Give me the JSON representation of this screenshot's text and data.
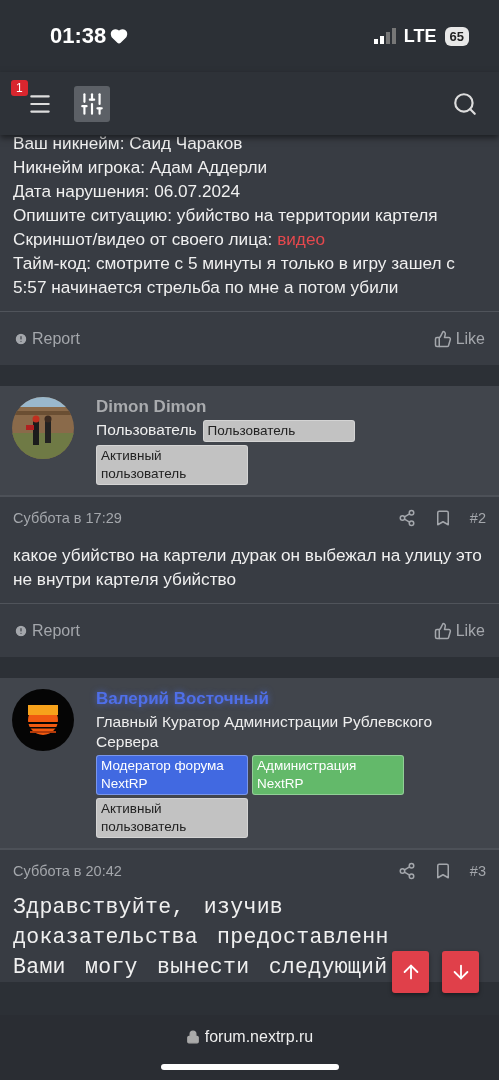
{
  "status_bar": {
    "time": "01:38",
    "network": "LTE",
    "battery": "65"
  },
  "header": {
    "notification_badge": "1"
  },
  "posts": [
    {
      "kind": "continued",
      "lines": [
        {
          "text": "Ваш никнейм: Саид Чараков"
        },
        {
          "text": "Никнейм игрока: Адам Аддерли"
        },
        {
          "text": "Дата нарушения: 06.07.2024"
        },
        {
          "text": "Опишите ситуацию: убийство на территории картеля"
        },
        {
          "text": "Скриншот/видео от своего лица: ",
          "link": "видео"
        },
        {
          "text": "Тайм-код: смотрите с 5 минуты я только в игру зашел с 5:57 начинается стрельба по мне а потом убили"
        }
      ],
      "footer": {
        "report": "Report",
        "like": "Like"
      }
    },
    {
      "kind": "member_reply",
      "author": {
        "name": "Dimon Dimon",
        "title": "Пользователь",
        "banners": [
          {
            "text": "Пользователь",
            "color": "#c2c2c2"
          },
          {
            "text": "Активный пользователь",
            "color": "#c2c2c2"
          }
        ]
      },
      "date": "Суббота в 17:29",
      "number": "#2",
      "lines": [
        {
          "text": "какое убийство на картели дурак он выбежал на улицу это не внутри картеля убийство"
        }
      ],
      "footer": {
        "report": "Report",
        "like": "Like"
      }
    },
    {
      "kind": "staff_reply",
      "author": {
        "name": "Валерий Восточный",
        "title": "Главный Куратор Администрации Рублевского Сервера",
        "banners": [
          {
            "text": "Модератор форума NextRP",
            "color": "#4169e1"
          },
          {
            "text": "Администрация NextRP",
            "color": "#63b96a"
          },
          {
            "text": "Активный пользователь",
            "color": "#c2c2c2"
          }
        ]
      },
      "date": "Суббота в 20:42",
      "number": "#3",
      "lines": [
        {
          "text": "Здравствуйте, изучив"
        },
        {
          "text": "доказательства предоставленн"
        },
        {
          "text": "Вами могу вынести следующий"
        }
      ]
    }
  ],
  "browser_bar": {
    "url": "forum.nextrp.ru"
  }
}
